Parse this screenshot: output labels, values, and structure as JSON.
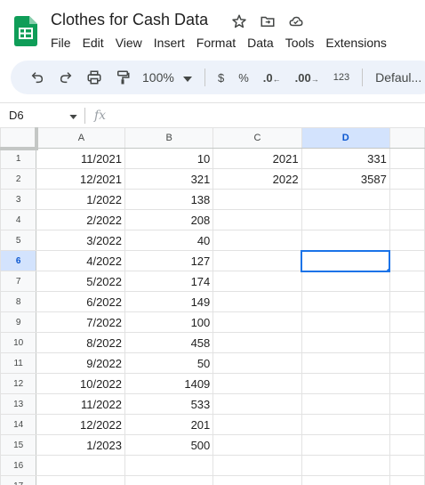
{
  "app": {
    "title": "Clothes for Cash Data",
    "brand_color": "#0f9d58"
  },
  "menu": [
    "File",
    "Edit",
    "View",
    "Insert",
    "Format",
    "Data",
    "Tools",
    "Extensions"
  ],
  "toolbar": {
    "zoom": "100%",
    "currency": "$",
    "percent": "%",
    "decrease_decimal": ".0",
    "increase_decimal": ".00",
    "number_format": "123",
    "font": "Defaul..."
  },
  "formula_bar": {
    "name_box": "D6",
    "fx": "fx",
    "value": ""
  },
  "sheet": {
    "columns": [
      "A",
      "B",
      "C",
      "D"
    ],
    "selected_column": "D",
    "selected_row": "6",
    "active_cell": "D6",
    "rows": [
      {
        "num": "1",
        "A": "11/2021",
        "B": "10",
        "C": "2021",
        "D": "331"
      },
      {
        "num": "2",
        "A": "12/2021",
        "B": "321",
        "C": "2022",
        "D": "3587"
      },
      {
        "num": "3",
        "A": "1/2022",
        "B": "138",
        "C": "",
        "D": ""
      },
      {
        "num": "4",
        "A": "2/2022",
        "B": "208",
        "C": "",
        "D": ""
      },
      {
        "num": "5",
        "A": "3/2022",
        "B": "40",
        "C": "",
        "D": ""
      },
      {
        "num": "6",
        "A": "4/2022",
        "B": "127",
        "C": "",
        "D": ""
      },
      {
        "num": "7",
        "A": "5/2022",
        "B": "174",
        "C": "",
        "D": ""
      },
      {
        "num": "8",
        "A": "6/2022",
        "B": "149",
        "C": "",
        "D": ""
      },
      {
        "num": "9",
        "A": "7/2022",
        "B": "100",
        "C": "",
        "D": ""
      },
      {
        "num": "10",
        "A": "8/2022",
        "B": "458",
        "C": "",
        "D": ""
      },
      {
        "num": "11",
        "A": "9/2022",
        "B": "50",
        "C": "",
        "D": ""
      },
      {
        "num": "12",
        "A": "10/2022",
        "B": "1409",
        "C": "",
        "D": ""
      },
      {
        "num": "13",
        "A": "11/2022",
        "B": "533",
        "C": "",
        "D": ""
      },
      {
        "num": "14",
        "A": "12/2022",
        "B": "201",
        "C": "",
        "D": ""
      },
      {
        "num": "15",
        "A": "1/2023",
        "B": "500",
        "C": "",
        "D": ""
      },
      {
        "num": "16",
        "A": "",
        "B": "",
        "C": "",
        "D": ""
      },
      {
        "num": "17",
        "A": "",
        "B": "",
        "C": "",
        "D": ""
      }
    ]
  }
}
